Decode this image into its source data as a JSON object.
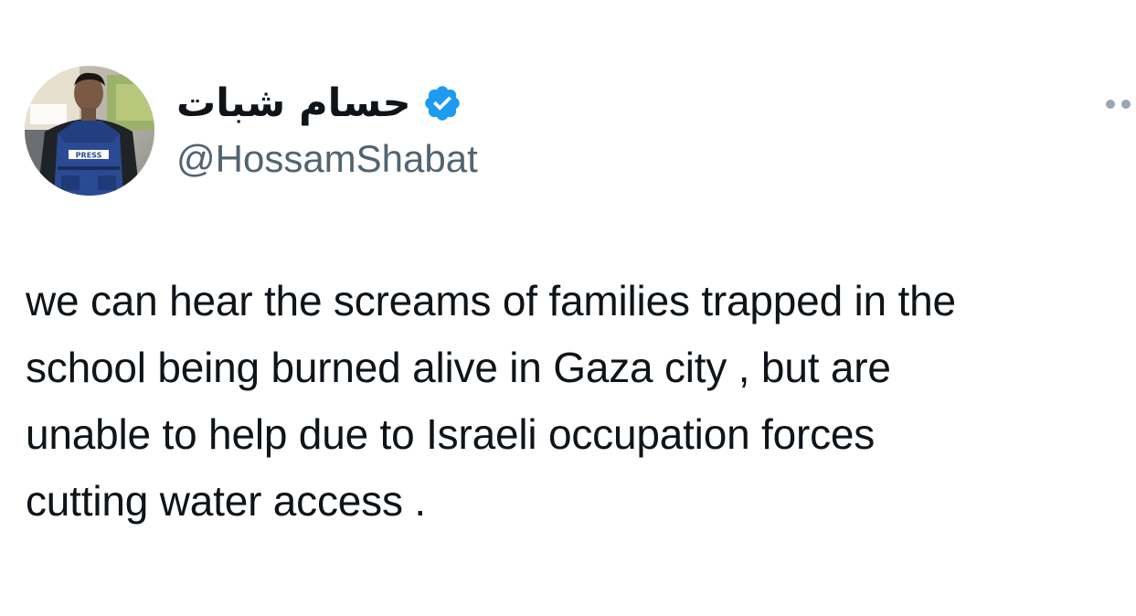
{
  "author": {
    "display_name": "حسام شبات",
    "handle": "@HossamShabat",
    "avatar_badge_text": "PRESS",
    "verified": true
  },
  "tweet": {
    "text": "we can hear the screams of families trapped in the\nschool being burned alive in Gaza city , but are\nunable to help due to Israeli occupation forces\ncutting water access ."
  },
  "icons": {
    "verified": "verified-badge-icon",
    "more": "more-options-icon"
  },
  "colors": {
    "verified_blue": "#1d9bf0",
    "text": "#0f1419",
    "secondary_text": "#536471"
  }
}
